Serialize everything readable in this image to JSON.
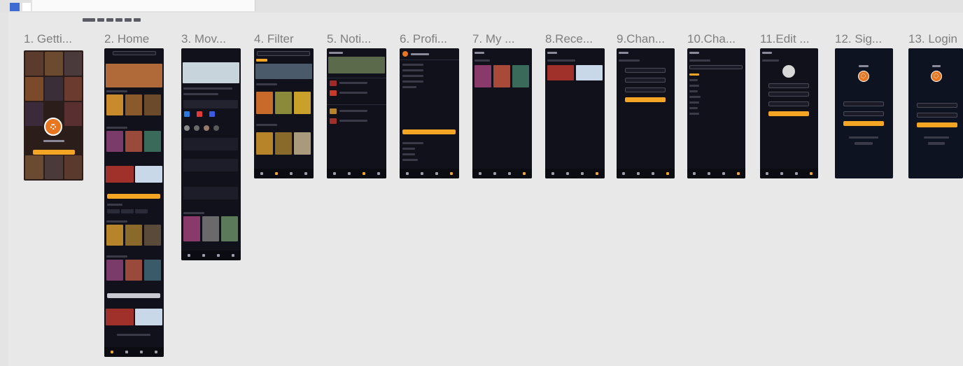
{
  "canvas": {
    "background": "#e8e8e8",
    "accent": "#f3a523",
    "screen_bg": "#10111a",
    "logo_color": "#e8751f"
  },
  "frames": [
    {
      "id": "f1",
      "title": "1. Getti...",
      "icon": "film-reel-icon"
    },
    {
      "id": "f2",
      "title": "2. Home"
    },
    {
      "id": "f3",
      "title": "3. Mov..."
    },
    {
      "id": "f4",
      "title": "4. Filter"
    },
    {
      "id": "f5",
      "title": "5. Noti..."
    },
    {
      "id": "f6",
      "title": "6. Profi..."
    },
    {
      "id": "f7",
      "title": "7. My ..."
    },
    {
      "id": "f8",
      "title": "8.Rece..."
    },
    {
      "id": "f9",
      "title": "9.Chan..."
    },
    {
      "id": "f10",
      "title": "10.Cha..."
    },
    {
      "id": "f11",
      "title": "11.Edit ..."
    },
    {
      "id": "f12",
      "title": "12. Sig..."
    },
    {
      "id": "f13",
      "title": "13. Login"
    }
  ]
}
